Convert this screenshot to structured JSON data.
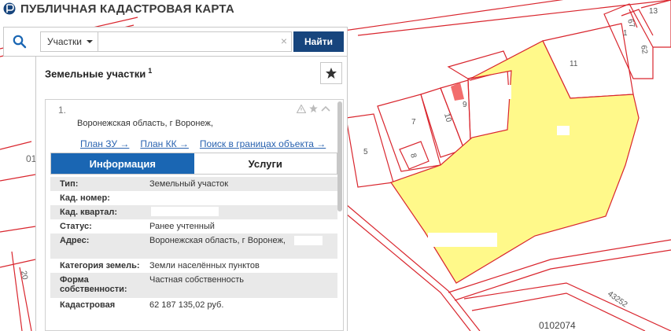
{
  "header": {
    "title": "ПУБЛИЧНАЯ КАДАСТРОВАЯ КАРТА"
  },
  "search": {
    "type_label": "Участки",
    "query_value": "",
    "find_label": "Найти"
  },
  "panel": {
    "title": "Земельные участки",
    "count": "1",
    "card": {
      "index": "1.",
      "address": "Воронежская область, г Воронеж,",
      "links": [
        "План ЗУ →",
        "План КК →",
        "Поиск в границах объекта →"
      ],
      "tabs": [
        "Информация",
        "Услуги"
      ],
      "rows": [
        {
          "label": "Тип:",
          "value": "Земельный участок"
        },
        {
          "label": "Кад. номер:",
          "value": ""
        },
        {
          "label": "Кад. квартал:",
          "value": ""
        },
        {
          "label": "Статус:",
          "value": "Ранее учтенный"
        },
        {
          "label": "Адрес:",
          "value": "Воронежская область, г Воронеж,"
        },
        {
          "label": "Категория земель:",
          "value": "Земли населённых пунктов"
        },
        {
          "label": "Форма собственности:",
          "value": "Частная собственность"
        },
        {
          "label": "Кадастровая",
          "value": "62 187 135,02 руб."
        }
      ]
    }
  },
  "map": {
    "labels": [
      "13",
      "67",
      "1",
      "62",
      "11",
      "9",
      "10",
      "7",
      "5",
      "8",
      "01",
      "20",
      "43252",
      "0102074"
    ],
    "colors": {
      "parcel_border": "#d9262e",
      "selected_fill": "#fff98a",
      "highlight": "#f26d6d"
    }
  },
  "colors": {
    "find_button": "#17457d",
    "active_tab": "#1a66b3",
    "link": "#2a63b0"
  }
}
